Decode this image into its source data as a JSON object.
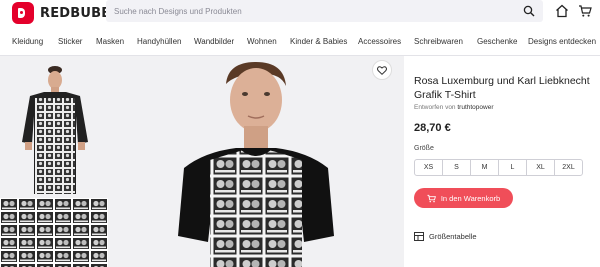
{
  "header": {
    "brand": "REDBUBBLE",
    "search_placeholder": "Suche nach Designs und Produkten",
    "icons": [
      "search-icon",
      "account-icon",
      "cart-icon"
    ]
  },
  "nav": {
    "items": [
      "Kleidung",
      "Sticker",
      "Masken",
      "Handyhüllen",
      "Wandbilder",
      "Wohnen",
      "Kinder & Babies",
      "Accessoires",
      "Schreibwaren",
      "Geschenke",
      "Designs entdecken"
    ]
  },
  "product": {
    "title": "Rosa Luxemburg und Karl Liebknecht Grafik T-Shirt",
    "designer_prefix": "Entworfen von",
    "designer": "truthtopower",
    "price": "28,70 €",
    "size_label": "Größe",
    "sizes": [
      "XS",
      "S",
      "M",
      "L",
      "XL",
      "2XL"
    ],
    "add_to_cart": "In den Warenkorb",
    "size_chart": "Größentabelle"
  },
  "colors": {
    "brand_red": "#e4002b",
    "cart_button": "#f04e59"
  }
}
